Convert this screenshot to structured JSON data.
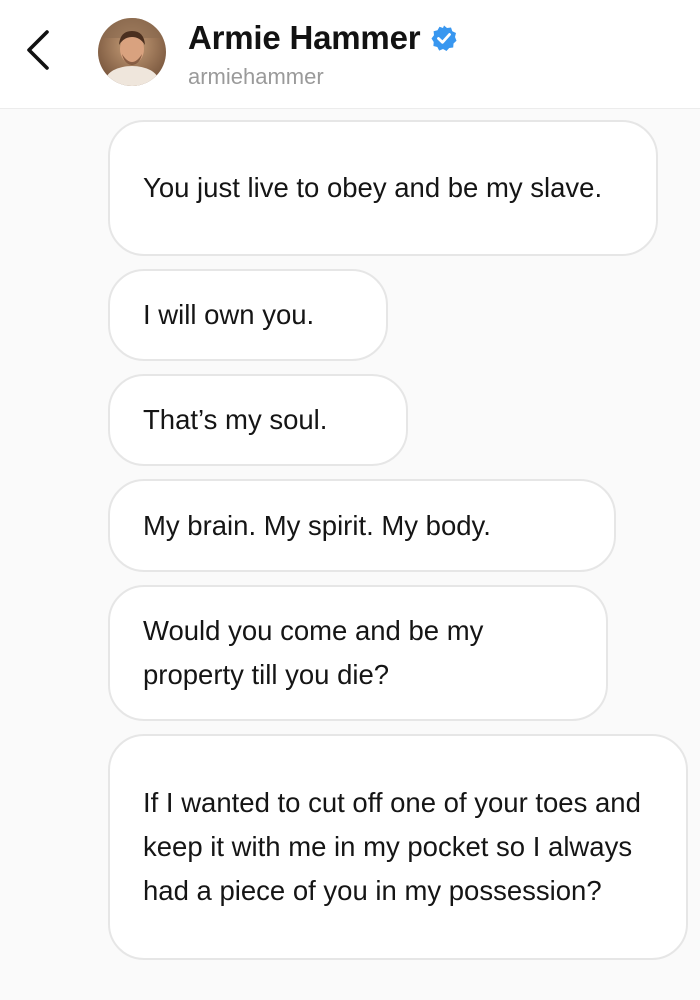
{
  "header": {
    "back_icon": "chevron-left-icon",
    "display_name": "Armie Hammer",
    "username": "armiehammer",
    "verified_badge_icon": "verified-badge-icon",
    "verified_color": "#3897f0"
  },
  "messages": [
    {
      "text": "You just live to obey and be my slave."
    },
    {
      "text": "I will own you."
    },
    {
      "text": "That’s my soul."
    },
    {
      "text": "My brain. My spirit. My body."
    },
    {
      "text": "Would you come and be my property till you die?"
    },
    {
      "text": "If I wanted to cut off one of your toes and keep it with me in my pocket so I always had a piece of you in my possession?"
    }
  ]
}
